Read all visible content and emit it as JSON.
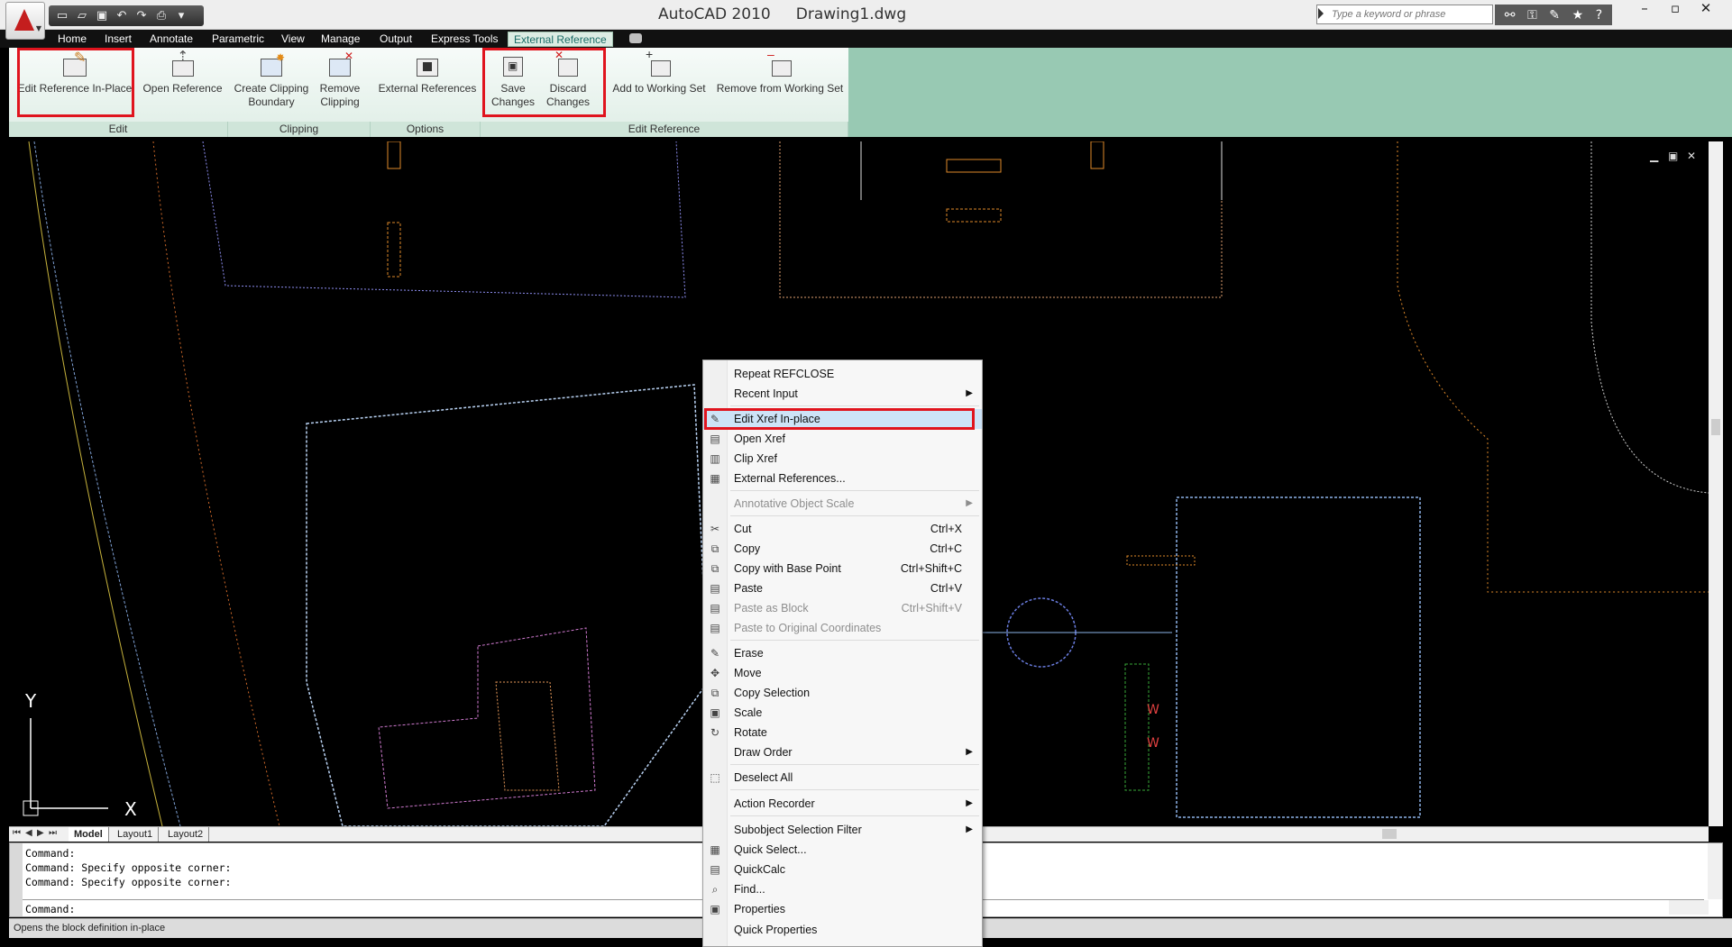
{
  "title": {
    "app": "AutoCAD 2010",
    "document": "Drawing1.dwg"
  },
  "search": {
    "placeholder": "Type a keyword or phrase"
  },
  "ribbon_tabs": [
    "Home",
    "Insert",
    "Annotate",
    "Parametric",
    "View",
    "Manage",
    "Output",
    "Express Tools",
    "External Reference"
  ],
  "ribbon": {
    "buttons": {
      "edit_in_place": "Edit Reference In-Place",
      "open_reference": "Open Reference",
      "create_clipping": [
        "Create Clipping",
        "Boundary"
      ],
      "remove_clipping": [
        "Remove",
        "Clipping"
      ],
      "external_references": "External References",
      "save_changes": [
        "Save",
        "Changes"
      ],
      "discard_changes": [
        "Discard",
        "Changes"
      ],
      "add_working_set": "Add to Working Set",
      "remove_working_set": "Remove from Working Set"
    },
    "panels": {
      "edit": "Edit",
      "clipping": "Clipping",
      "options": "Options",
      "edit_reference": "Edit Reference"
    }
  },
  "layout_tabs": [
    "Model",
    "Layout1",
    "Layout2"
  ],
  "command_lines": [
    "Command:",
    "Command: Specify opposite corner:",
    "Command: Specify opposite corner:"
  ],
  "command_prompt": "Command:",
  "status_text": "Opens the block definition in-place",
  "context_menu": {
    "items": [
      {
        "label": "Repeat REFCLOSE"
      },
      {
        "label": "Recent Input",
        "submenu": true
      },
      {
        "label": "Edit Xref In-place",
        "highlighted": true
      },
      {
        "label": "Open Xref"
      },
      {
        "label": "Clip Xref"
      },
      {
        "label": "External References..."
      },
      {
        "label": "Annotative Object Scale",
        "submenu": true,
        "disabled": true
      },
      {
        "label": "Cut",
        "shortcut": "Ctrl+X"
      },
      {
        "label": "Copy",
        "shortcut": "Ctrl+C"
      },
      {
        "label": "Copy with Base Point",
        "shortcut": "Ctrl+Shift+C"
      },
      {
        "label": "Paste",
        "shortcut": "Ctrl+V"
      },
      {
        "label": "Paste as Block",
        "shortcut": "Ctrl+Shift+V",
        "disabled": true
      },
      {
        "label": "Paste to Original Coordinates",
        "disabled": true
      },
      {
        "label": "Erase"
      },
      {
        "label": "Move"
      },
      {
        "label": "Copy Selection"
      },
      {
        "label": "Scale"
      },
      {
        "label": "Rotate"
      },
      {
        "label": "Draw Order",
        "submenu": true
      },
      {
        "label": "Deselect All"
      },
      {
        "label": "Action Recorder",
        "submenu": true
      },
      {
        "label": "Subobject Selection Filter",
        "submenu": true
      },
      {
        "label": "Quick Select..."
      },
      {
        "label": "QuickCalc"
      },
      {
        "label": "Find..."
      },
      {
        "label": "Properties"
      },
      {
        "label": "Quick Properties"
      }
    ]
  },
  "ucs": {
    "y": "Y",
    "x": "X"
  },
  "drawing_marks": {
    "w1": "W",
    "w2": "W"
  },
  "colors": {
    "highlight_box": "#e0141e",
    "ribbon_bg": "#dfeee6",
    "active_tab": "#1a6b66",
    "menu_highlight": "#cde3f7"
  }
}
